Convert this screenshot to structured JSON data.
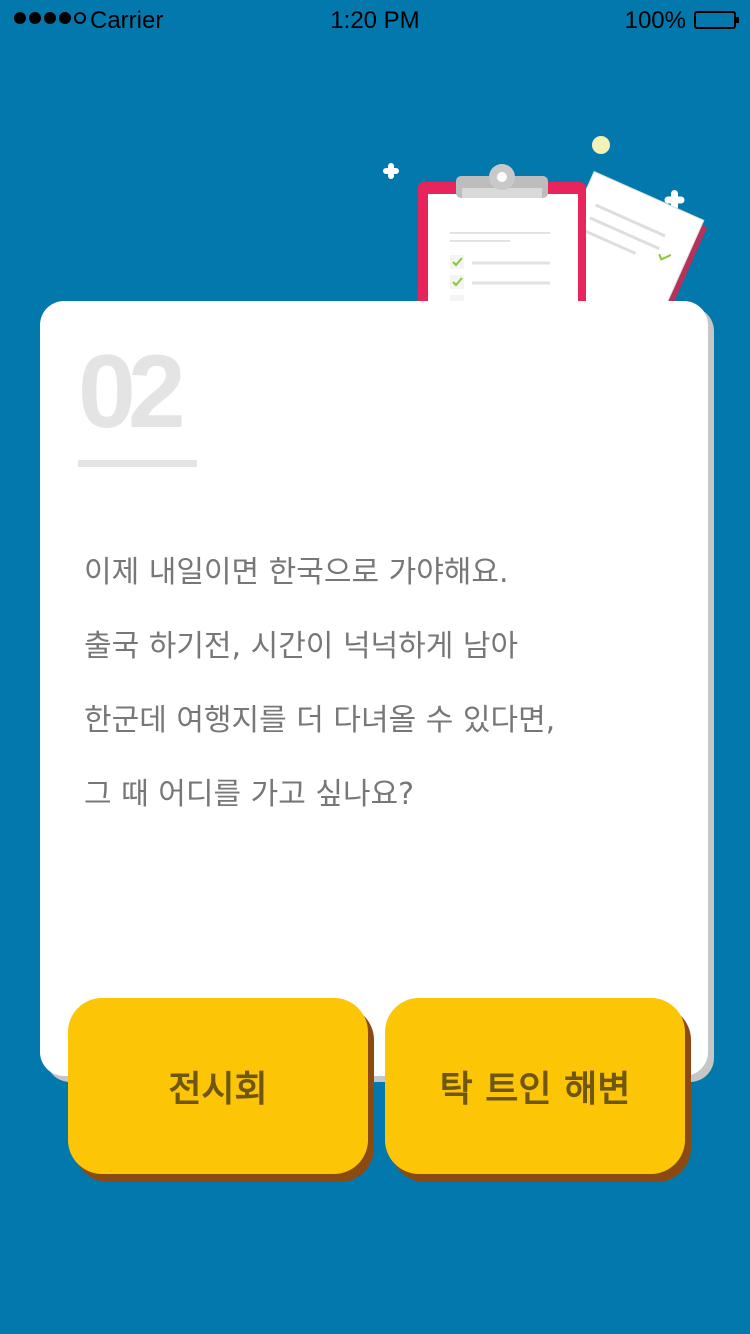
{
  "status_bar": {
    "carrier": "Carrier",
    "time": "1:20 PM",
    "battery": "100%",
    "signal_bars_filled": 4,
    "signal_bars_total": 5
  },
  "illustration": {
    "icon": "clipboard-checklist-icon"
  },
  "card": {
    "step_number": "02",
    "question_lines": [
      "이제 내일이면 한국으로 가야해요.",
      "출국 하기전, 시간이 넉넉하게 남아",
      "한군데 여행지를 더 다녀올 수 있다면,",
      "그 때 어디를 가고 싶나요?"
    ]
  },
  "choices": {
    "left_label": "전시회",
    "right_label": "탁 트인 해변"
  },
  "colors": {
    "background": "#0378ad",
    "card": "#ffffff",
    "button": "#fcc505",
    "button_shadow": "#8b4a12",
    "clipboard_frame": "#e8255b"
  }
}
